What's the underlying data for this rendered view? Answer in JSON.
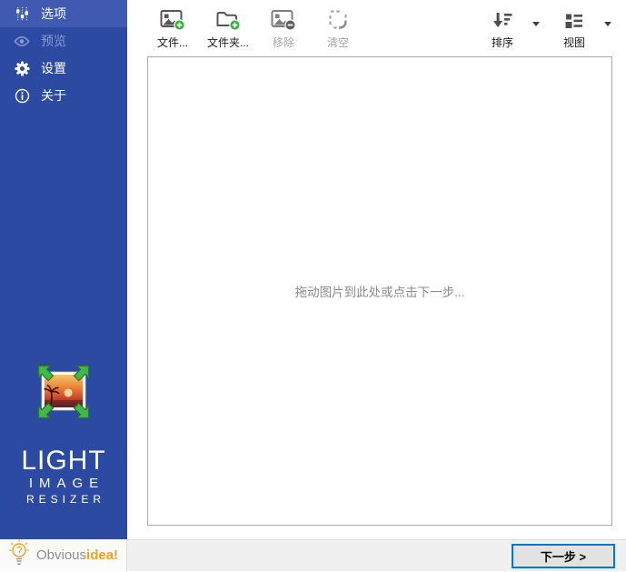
{
  "sidebar": {
    "items": [
      {
        "label": "选项",
        "state": "selected"
      },
      {
        "label": "预览",
        "state": "disabled"
      },
      {
        "label": "设置",
        "state": "normal"
      },
      {
        "label": "关于",
        "state": "normal"
      }
    ],
    "brand": {
      "line1": "LIGHT",
      "line2": "IMAGE",
      "line3": "RESIZER"
    }
  },
  "toolbar": {
    "file_label": "文件...",
    "folder_label": "文件夹...",
    "remove_label": "移除",
    "clear_label": "清空",
    "sort_label": "排序",
    "view_label": "视图"
  },
  "dropzone": {
    "hint": "拖动图片到此处或点击下一步..."
  },
  "footer": {
    "next_label": "下一步 >",
    "brand_gray": "Obvious",
    "brand_orange": "idea!"
  },
  "colors": {
    "sidebar_bg": "#2d4aa2",
    "sidebar_selected": "#4059b1",
    "accent_green": "#2fb32f",
    "button_border": "#0078d7",
    "brand_orange": "#f2a31d"
  }
}
